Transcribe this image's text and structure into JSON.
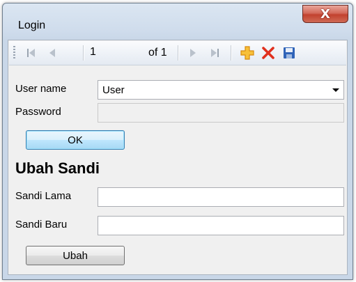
{
  "window": {
    "title": "Login",
    "close_glyph": "X"
  },
  "toolbar": {
    "icons": [
      "move-first-icon",
      "move-previous-icon",
      "move-next-icon",
      "move-last-icon",
      "add-new-icon",
      "delete-icon",
      "save-icon"
    ],
    "position_value": "1",
    "count_label": "of 1",
    "colors": {
      "add": "#f2a11a",
      "delete": "#e0301e",
      "save": "#2f63b8"
    }
  },
  "login": {
    "username_label": "User name",
    "username_value": "User",
    "password_label": "Password",
    "password_value": "",
    "ok_label": "OK"
  },
  "change_password": {
    "heading": "Ubah Sandi",
    "old_label": "Sandi Lama",
    "old_value": "",
    "new_label": "Sandi Baru",
    "new_value": "",
    "submit_label": "Ubah"
  }
}
